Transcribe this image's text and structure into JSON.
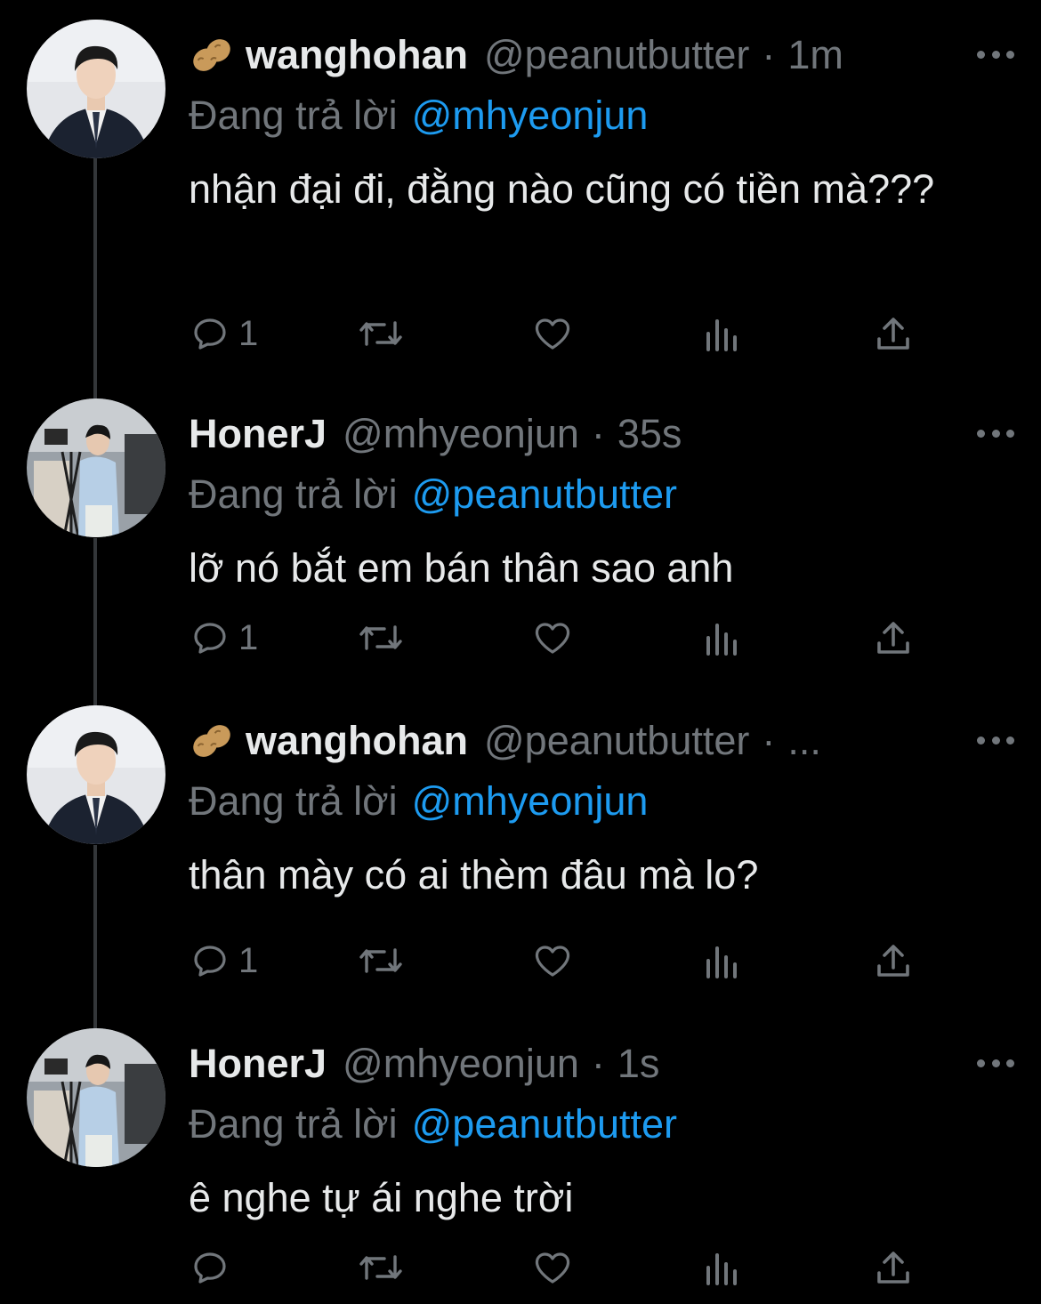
{
  "tweets": [
    {
      "display_name": "wanghohan",
      "name_emoji": "peanut-emoji",
      "handle": "@peanutbutter",
      "separator": "·",
      "time": "1m",
      "replying_label": "Đang trả lời",
      "replying_to": "@mhyeonjun",
      "text": "nhận đại đi, đằng nào cũng có tiền mà???",
      "reply_count": "1",
      "avatar": "suit-avatar"
    },
    {
      "display_name": "HonerJ",
      "handle": "@mhyeonjun",
      "separator": "·",
      "time": "35s",
      "replying_label": "Đang trả lời",
      "replying_to": "@peanutbutter",
      "text": "lỡ nó bắt em bán thân sao anh",
      "reply_count": "1",
      "avatar": "camera-avatar"
    },
    {
      "display_name": "wanghohan",
      "name_emoji": "peanut-emoji",
      "handle": "@peanutbutter",
      "separator": "·",
      "time": "...",
      "replying_label": "Đang trả lời",
      "replying_to": "@mhyeonjun",
      "text": "thân mày có ai thèm đâu mà lo?",
      "reply_count": "1",
      "avatar": "suit-avatar"
    },
    {
      "display_name": "HonerJ",
      "handle": "@mhyeonjun",
      "separator": "·",
      "time": "1s",
      "replying_label": "Đang trả lời",
      "replying_to": "@peanutbutter",
      "text": "ê nghe tự ái nghe trời",
      "reply_count": "",
      "avatar": "camera-avatar"
    }
  ],
  "icons": {
    "reply": "reply-icon",
    "retweet": "retweet-icon",
    "like": "heart-icon",
    "views": "views-icon",
    "share": "share-icon",
    "more": "more-icon"
  },
  "colors": {
    "background": "#000000",
    "text": "#e7e9ea",
    "muted": "#71767b",
    "link": "#1d9bf0",
    "thread_line": "#333639"
  }
}
